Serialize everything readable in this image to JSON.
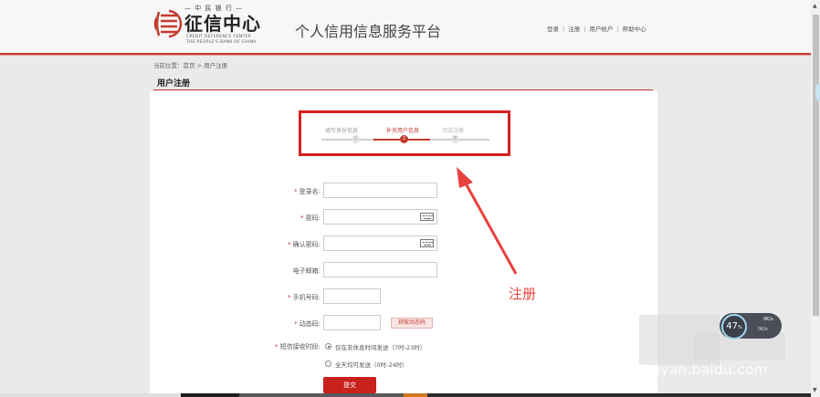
{
  "header": {
    "logo_top_text": "— 中   民 银 行 —",
    "logo_cn": "征信中心",
    "logo_en_line1": "CREDIT  REFERENCE  CENTER",
    "logo_en_line2": "THE PEOPLE'S BANK OF CHINA",
    "site_title": "个人信用信息服务平台",
    "nav": [
      "登录",
      "注册",
      "用户帐户",
      "帮助中心"
    ],
    "nav_separator": "|"
  },
  "breadcrumb": "当前位置：首页 > 用户注册",
  "section_title": "用户注册",
  "steps": [
    {
      "label": "填写身份信息",
      "number": "1",
      "active": false
    },
    {
      "label": "补充用户信息",
      "number": "2",
      "active": true
    },
    {
      "label": "完成注册",
      "number": "3",
      "active": false
    }
  ],
  "form": {
    "required_mark": "*",
    "fields": [
      {
        "label": "登录名:",
        "required": true,
        "value": ""
      },
      {
        "label": "密码:",
        "required": true,
        "value": "",
        "keyboard_icon": "keyboard-icon"
      },
      {
        "label": "确认密码:",
        "required": true,
        "value": "",
        "keyboard_icon": "keyboard-icon"
      },
      {
        "label": "电子邮箱:",
        "required": false,
        "value": ""
      },
      {
        "label": "手机号码:",
        "required": true,
        "value": ""
      },
      {
        "label": "动态码:",
        "required": true,
        "value": ""
      }
    ],
    "get_code_button": "获取动态码",
    "sms_label": "短信接收时段:",
    "sms_options": [
      {
        "label": "仅在非休息时间发送（7时-23时）",
        "checked": true
      },
      {
        "label": "全天均可发送（0时-24时）",
        "checked": false
      }
    ],
    "submit_label": "提交"
  },
  "annotation": {
    "text": "注册",
    "color": "#e8423e"
  },
  "speed_widget": {
    "value": "47",
    "unit": "%",
    "line1": "0K/s",
    "line2": "0K/s"
  },
  "watermark": "jingyan.baidu.com",
  "colors": {
    "brand_red": "#c33a2e",
    "highlight_box": "#d51f1f",
    "submit_button": "#c8221c",
    "page_background": "#eaeaea"
  }
}
